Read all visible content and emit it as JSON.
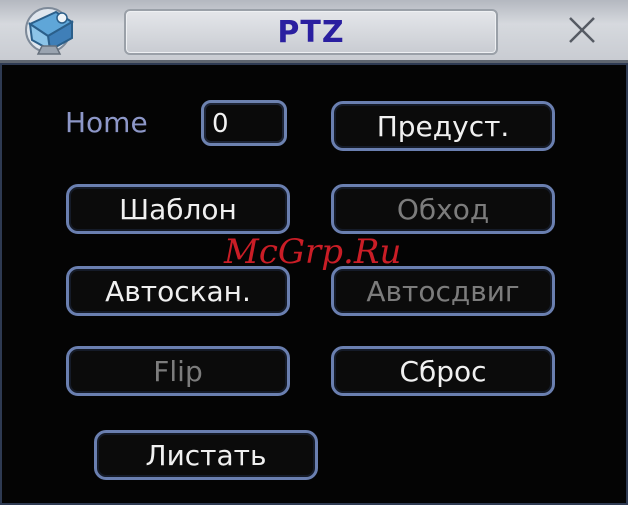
{
  "window": {
    "title": "PTZ"
  },
  "home": {
    "label": "Home",
    "value": "0"
  },
  "buttons": {
    "preset": "Предуст.",
    "pattern": "Шаблон",
    "tour": "Обход",
    "autoscan": "Автоскан.",
    "autopan": "Автосдвиг",
    "flip": "Flip",
    "reset": "Сброс",
    "page": "Листать"
  },
  "watermark": "McGrp.Ru",
  "colors": {
    "title_text": "#2a1fa0",
    "label_text": "#8d97c8",
    "button_border": "#6a7fb0",
    "disabled_text": "#7c7c7c",
    "watermark": "#e0202a"
  },
  "icons": {
    "app": "camera-app-icon",
    "close": "close-icon"
  }
}
